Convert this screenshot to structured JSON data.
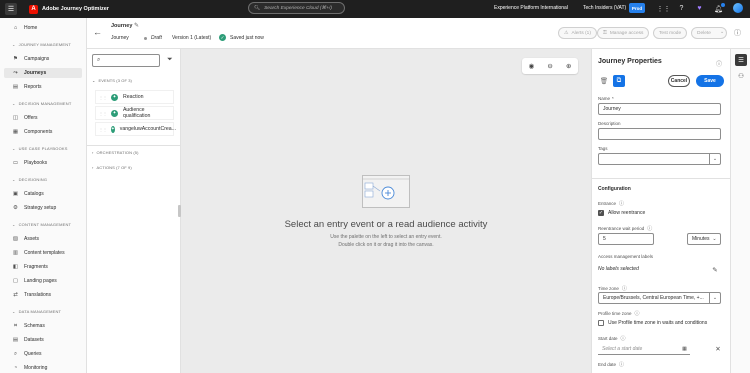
{
  "topbar": {
    "app_name": "Adobe Journey Optimizer",
    "search_placeholder": "Search Experience Cloud (⌘+/)",
    "org_name": "Experience Platform International",
    "sandbox_name": "Tech Insiders (VAT)",
    "sandbox_badge": "Prod"
  },
  "nav": {
    "home": "Home",
    "journey_management": "JOURNEY MANAGEMENT",
    "campaigns": "Campaigns",
    "journeys": "Journeys",
    "reports": "Reports",
    "decision_management": "DECISION MANAGEMENT",
    "offers": "Offers",
    "components": "Components",
    "use_case_playbooks": "USE CASE PLAYBOOKS",
    "playbooks": "Playbooks",
    "decisioning": "DECISIONING",
    "catalogs": "Catalogs",
    "strategy_setup": "Strategy setup",
    "content_management": "CONTENT MANAGEMENT",
    "assets": "Assets",
    "content_templates": "Content templates",
    "fragments": "Fragments",
    "landing_pages": "Landing pages",
    "translations": "Translations",
    "data_management": "DATA MANAGEMENT",
    "schemas": "Schemas",
    "datasets": "Datasets",
    "queries": "Queries",
    "monitoring": "Monitoring"
  },
  "header": {
    "title": "Journey",
    "breadcrumb": "Journey",
    "status": "Draft",
    "version": "Version 1 (Latest)",
    "saved": "Saved just now",
    "alerts_label": "Alerts (1)",
    "manage_access_label": "Manage access",
    "test_mode_label": "Test mode",
    "delete_label": "Delete"
  },
  "palette": {
    "events_section": "EVENTS (3 OF 3)",
    "events": [
      {
        "label": "Reaction",
        "color": "#2d9d78"
      },
      {
        "label": "Audience qualification",
        "color": "#2d9d78"
      },
      {
        "label": "vangeluwAccountCrea...",
        "color": "#2d9d78"
      }
    ],
    "orchestration_section": "ORCHESTRATION (5)",
    "actions_section": "ACTIONS (7 OF 9)"
  },
  "canvas": {
    "empty_title": "Select an entry event or a read audience activity",
    "empty_line1": "Use the palette on the left to select an entry event.",
    "empty_line2": "Double click on it or drag it into the canvas."
  },
  "properties": {
    "title": "Journey Properties",
    "cancel_label": "Cancel",
    "save_label": "Save",
    "name_label": "Name",
    "name_required": "*",
    "name_value": "Journey",
    "description_label": "Description",
    "tags_label": "Tags",
    "configuration_label": "Configuration",
    "entrance_label": "Entrance",
    "allow_reentrance_label": "Allow reentrance",
    "allow_reentrance_checked": true,
    "reentrance_wait_label": "Reentrance wait period",
    "reentrance_wait_value": "5",
    "reentrance_unit": "Minutes",
    "access_labels_label": "Access management labels",
    "no_labels_text": "No labels selected",
    "time_zone_label": "Time zone",
    "time_zone_value": "Europe/Brussels, Central European Time, +...",
    "profile_tz_label": "Profile time zone",
    "profile_tz_check_label": "Use Profile time zone in waits and conditions",
    "profile_tz_checked": false,
    "start_date_label": "Start date",
    "start_date_placeholder": "Select a start date",
    "end_date_label": "End date"
  },
  "colors": {
    "accent": "#1473e6",
    "topbar_bg": "#1f1f1f",
    "success": "#2d9d78"
  }
}
